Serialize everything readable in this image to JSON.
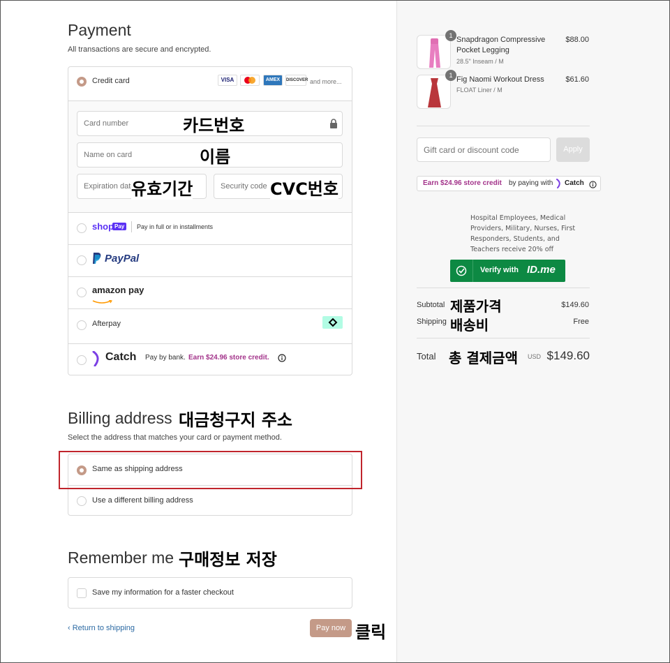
{
  "payment": {
    "title": "Payment",
    "subtitle": "All transactions are secure and encrypted.",
    "credit_card_label": "Credit card",
    "card_brands": [
      "VISA",
      "MC",
      "AMEX",
      "DISCOVER"
    ],
    "and_more": "and more...",
    "card_number_placeholder": "Card number",
    "name_placeholder": "Name on card",
    "expiration_placeholder": "Expiration date",
    "security_placeholder": "Security code",
    "shop_pay_logo": "shop",
    "shop_pay_badge": "Pay",
    "shop_pay_text": "Pay in full or in installments",
    "paypal_label": "PayPal",
    "amazon_label": "amazon pay",
    "afterpay_label": "Afterpay",
    "catch_label": "Catch",
    "catch_text": "Pay by bank.",
    "catch_credit": "Earn $24.96 store credit."
  },
  "billing": {
    "title": "Billing address",
    "subtitle": "Select the address that matches your card or payment method.",
    "same_label": "Same as shipping address",
    "different_label": "Use a different billing address"
  },
  "remember": {
    "title": "Remember me",
    "save_label": "Save my information for a faster checkout"
  },
  "footer": {
    "return_label": "Return to shipping",
    "pay_now_label": "Pay now"
  },
  "annotations": {
    "card_number": "카드번호",
    "name": "이름",
    "expiry": "유효기간",
    "cvc": "CVC번호",
    "billing": "대금청구지 주소",
    "remember": "구매정보 저장",
    "click": "클릭",
    "product_price": "제품가격",
    "shipping": "배송비",
    "total": "총 결제금액"
  },
  "order": {
    "items": [
      {
        "name": "Snapdragon Compressive Pocket Legging",
        "variant": "28.5\" Inseam / M",
        "price": "$88.00",
        "qty": "1"
      },
      {
        "name": "Fig Naomi Workout Dress",
        "variant": "FLOAT Liner / M",
        "price": "$61.60",
        "qty": "1"
      }
    ],
    "discount_placeholder": "Gift card or discount code",
    "apply_label": "Apply",
    "catch_promo_earn": "Earn $24.96 store credit",
    "catch_promo_by": "by paying with",
    "catch_promo_brand": "Catch",
    "idme_text": "Hospital Employees, Medical Providers, Military, Nurses, First Responders, Students, and Teachers receive 20% off",
    "idme_button_prefix": "Verify with",
    "idme_button_brand": "ID.me",
    "subtotal_label": "Subtotal",
    "subtotal_value": "$149.60",
    "shipping_label": "Shipping",
    "shipping_value": "Free",
    "total_label": "Total",
    "currency": "USD",
    "total_value": "$149.60"
  },
  "colors": {
    "accent": "#c49a88",
    "pay_button": "#c49a88",
    "catch_pink": "#a3338a",
    "idme_green": "#0d8943",
    "highlight_red": "#c0252c"
  }
}
